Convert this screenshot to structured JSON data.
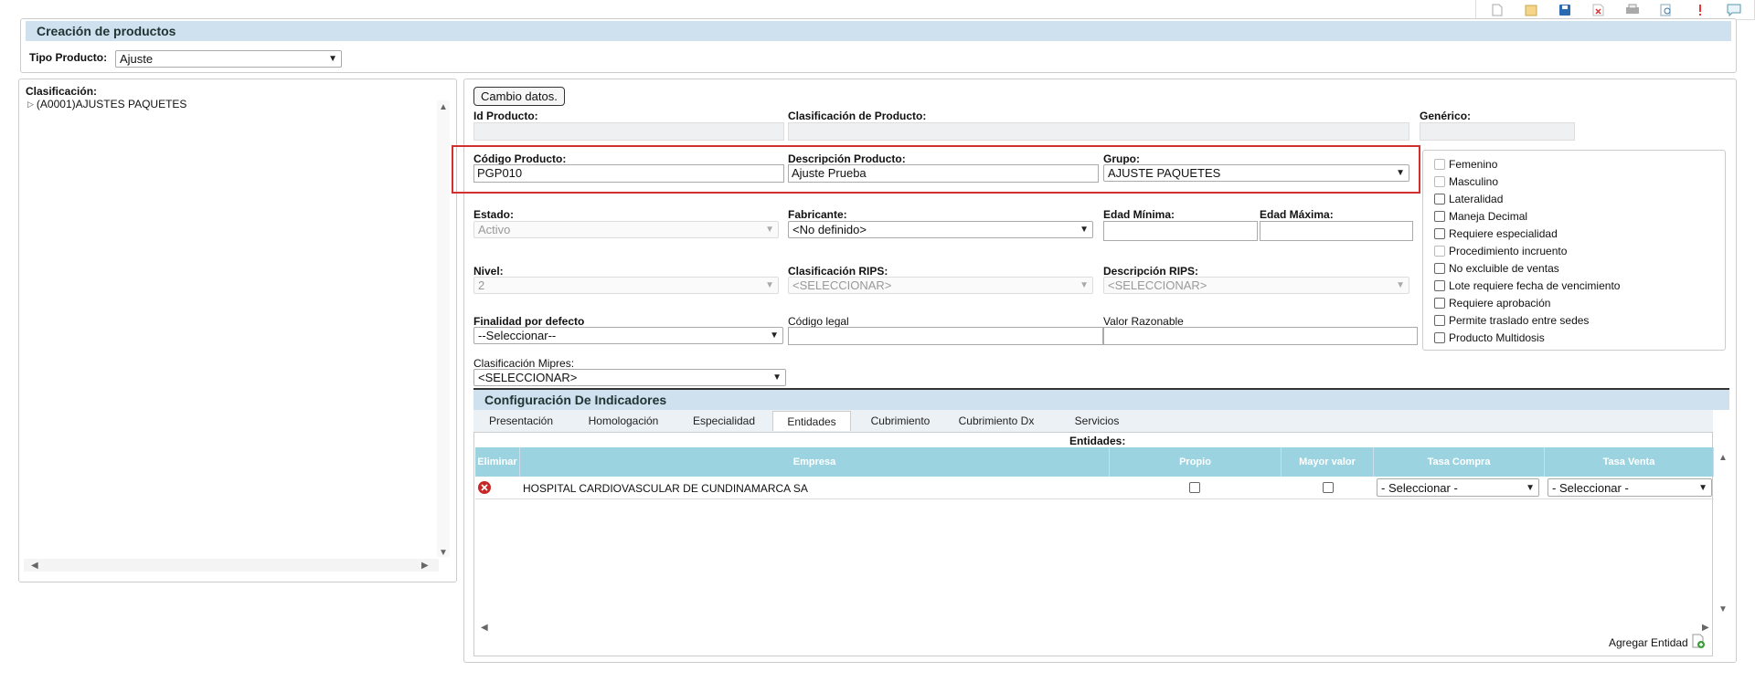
{
  "toolbar": {
    "icons": [
      "new-icon",
      "open-icon",
      "save-icon",
      "cancel-icon",
      "print-icon",
      "preview-icon",
      "alert-icon",
      "comment-icon"
    ]
  },
  "header": {
    "title": "Creación de productos",
    "tipo_label": "Tipo Producto:",
    "tipo_value": "Ajuste"
  },
  "tree": {
    "label": "Clasificación:",
    "node": "(A0001)AJUSTES PAQUETES"
  },
  "form": {
    "cambio_button": "Cambio datos.",
    "id_label": "Id Producto:",
    "id_value": "",
    "clasif_label": "Clasificación de Producto:",
    "clasif_value": "",
    "generico_label": "Genérico:",
    "generico_value": "",
    "codigo_label": "Código Producto:",
    "codigo_value": "PGP010",
    "descripcion_label": "Descripción Producto:",
    "descripcion_value": "Ajuste Prueba",
    "grupo_label": "Grupo:",
    "grupo_value": "AJUSTE PAQUETES",
    "estado_label": "Estado:",
    "estado_value": "Activo",
    "fabricante_label": "Fabricante:",
    "fabricante_value": "<No definido>",
    "edad_min_label": "Edad Mínima:",
    "edad_min_value": "",
    "edad_max_label": "Edad Máxima:",
    "edad_max_value": "",
    "nivel_label": "Nivel:",
    "nivel_value": "2",
    "clasif_rips_label": "Clasificación RIPS:",
    "clasif_rips_value": "<SELECCIONAR>",
    "desc_rips_label": "Descripción RIPS:",
    "desc_rips_value": "<SELECCIONAR>",
    "finalidad_label": "Finalidad por defecto",
    "finalidad_value": "--Seleccionar--",
    "codigo_legal_label": "Código legal",
    "codigo_legal_value": "",
    "valor_label": "Valor Razonable",
    "valor_value": "",
    "mipres_label": "Clasificación Mipres:",
    "mipres_value": "<SELECCIONAR>"
  },
  "options": {
    "femenino": "Femenino",
    "masculino": "Masculino",
    "lateralidad": "Lateralidad",
    "decimal": "Maneja Decimal",
    "especialidad": "Requiere especialidad",
    "incruento": "Procedimiento incruento",
    "no_excluible": "No excluible de ventas",
    "lote": "Lote requiere fecha de vencimiento",
    "aprobacion": "Requiere aprobación",
    "traslado": "Permite traslado entre sedes",
    "multidosis": "Producto Multidosis"
  },
  "indicadores": {
    "title": "Configuración De Indicadores",
    "tabs": [
      "Presentación",
      "Homologación",
      "Especialidad",
      "Entidades",
      "Cubrimiento",
      "Cubrimiento Dx",
      "Servicios"
    ],
    "active_tab": "Entidades",
    "entidades_label": "Entidades:",
    "columns": [
      "Eliminar",
      "Empresa",
      "Propio",
      "Mayor valor",
      "Tasa Compra",
      "Tasa Venta"
    ],
    "rows": [
      {
        "empresa": "HOSPITAL CARDIOVASCULAR DE CUNDINAMARCA SA",
        "propio": false,
        "mayor_valor": false,
        "tasa_compra": "- Seleccionar -",
        "tasa_venta": "- Seleccionar -"
      }
    ],
    "agregar": "Agregar Entidad"
  },
  "colors": {
    "accent": "#cfe0ee",
    "table_header": "#9cd3e0",
    "highlight": "#d32f2f"
  }
}
